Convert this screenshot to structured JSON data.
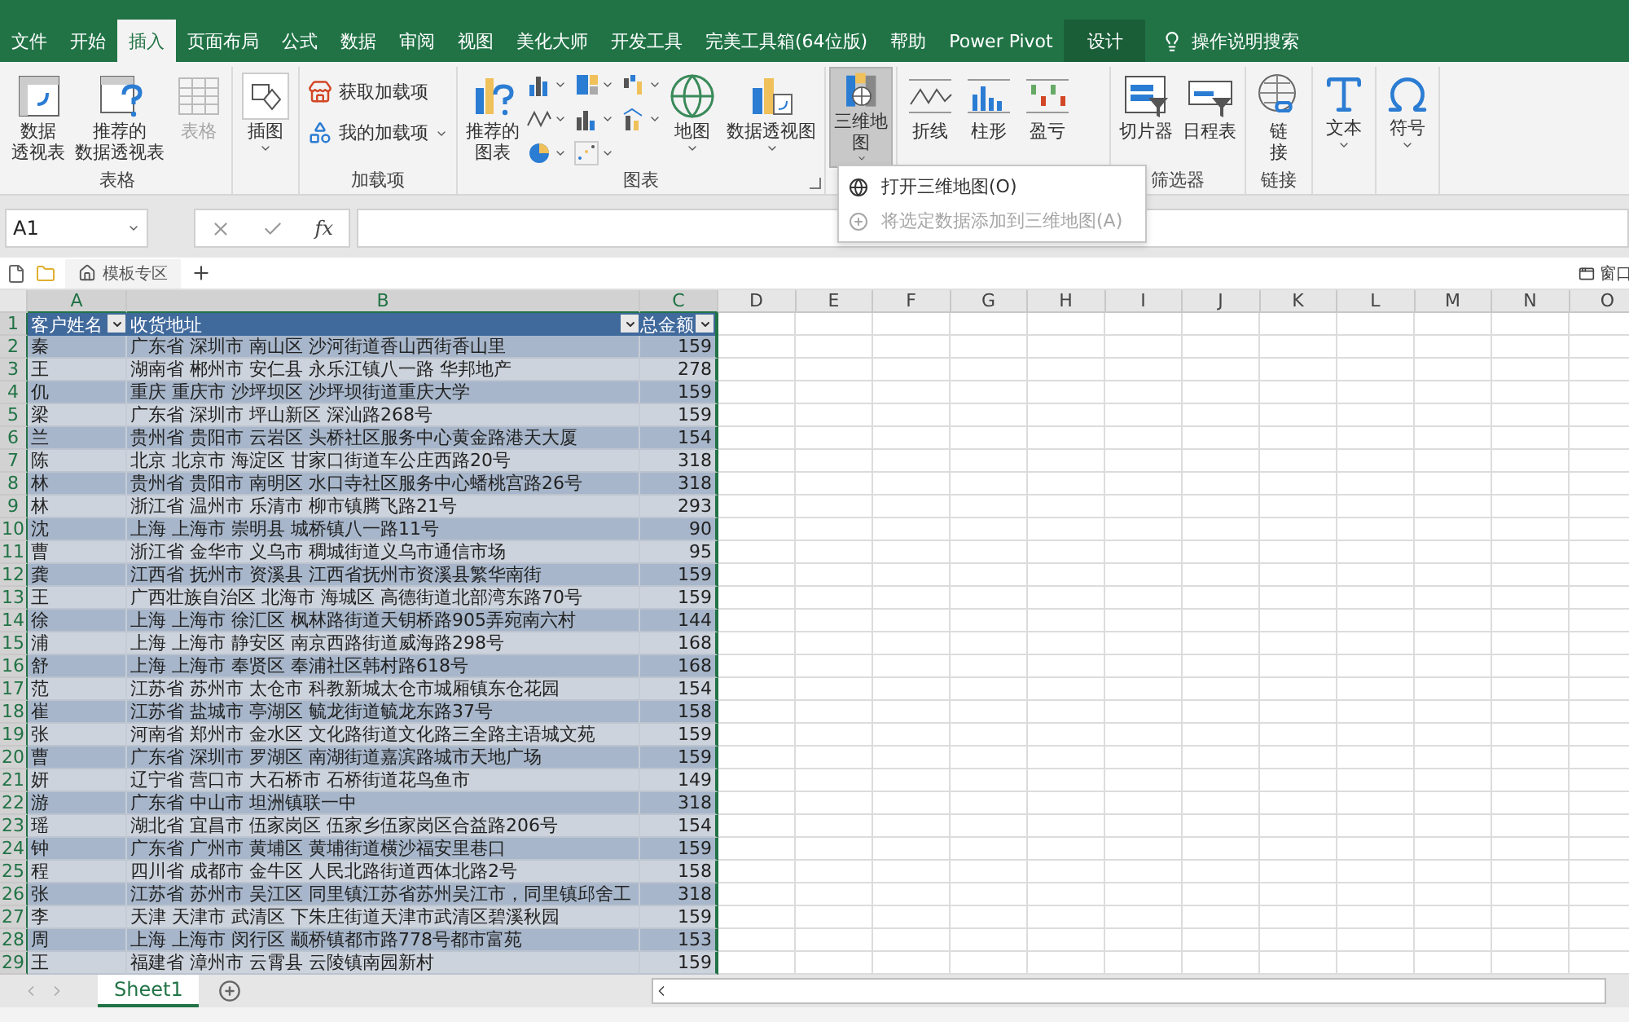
{
  "ribbon_tabs": [
    {
      "label": "文件",
      "selected": false,
      "kind": "normal"
    },
    {
      "label": "开始",
      "selected": false,
      "kind": "normal"
    },
    {
      "label": "插入",
      "selected": true,
      "kind": "normal"
    },
    {
      "label": "页面布局",
      "selected": false,
      "kind": "normal"
    },
    {
      "label": "公式",
      "selected": false,
      "kind": "normal"
    },
    {
      "label": "数据",
      "selected": false,
      "kind": "normal"
    },
    {
      "label": "审阅",
      "selected": false,
      "kind": "normal"
    },
    {
      "label": "视图",
      "selected": false,
      "kind": "normal"
    },
    {
      "label": "美化大师",
      "selected": false,
      "kind": "normal"
    },
    {
      "label": "开发工具",
      "selected": false,
      "kind": "normal"
    },
    {
      "label": "完美工具箱(64位版)",
      "selected": false,
      "kind": "normal"
    },
    {
      "label": "帮助",
      "selected": false,
      "kind": "normal"
    },
    {
      "label": "Power Pivot",
      "selected": false,
      "kind": "normal"
    },
    {
      "label": "设计",
      "selected": false,
      "kind": "contextual"
    }
  ],
  "tell_me": {
    "placeholder": "操作说明搜索"
  },
  "ribbon_groups": [
    {
      "label": "表格",
      "buttons": [
        {
          "kind": "large",
          "label_lines": [
            "数据",
            "透视表"
          ],
          "dropdown": false,
          "disabled": false,
          "pressed": false
        },
        {
          "kind": "large",
          "label_lines": [
            "推荐的",
            "数据透视表"
          ],
          "dropdown": false,
          "disabled": false,
          "pressed": false
        },
        {
          "kind": "large",
          "label_lines": [
            "表格"
          ],
          "dropdown": false,
          "disabled": true,
          "pressed": false
        }
      ]
    },
    {
      "buttons": [
        {
          "kind": "large",
          "label_lines": [
            "插图"
          ],
          "dropdown": true,
          "disabled": false,
          "pressed": false
        }
      ]
    },
    {
      "label": "加载项",
      "buttons": [
        {
          "kind": "small",
          "label_lines": [
            "获取加载项"
          ],
          "dropdown": false,
          "disabled": false,
          "pressed": false
        },
        {
          "kind": "small",
          "label_lines": [
            "我的加载项"
          ],
          "dropdown": true,
          "disabled": false,
          "pressed": false
        }
      ]
    },
    {
      "label": "图表",
      "launcher": true,
      "buttons": [
        {
          "kind": "large",
          "label_lines": [
            "推荐的",
            "图表"
          ],
          "dropdown": false,
          "disabled": false,
          "pressed": false
        },
        {
          "kind": "icon",
          "dropdown": true,
          "disabled": false,
          "pressed": false
        },
        {
          "kind": "icon",
          "dropdown": true,
          "disabled": false,
          "pressed": false
        },
        {
          "kind": "icon",
          "dropdown": true,
          "disabled": false,
          "pressed": false
        },
        {
          "kind": "icon",
          "dropdown": true,
          "disabled": false,
          "pressed": false
        },
        {
          "kind": "icon",
          "dropdown": true,
          "disabled": false,
          "pressed": false
        },
        {
          "kind": "icon",
          "dropdown": true,
          "disabled": false,
          "pressed": false
        },
        {
          "kind": "icon",
          "dropdown": true,
          "disabled": false,
          "pressed": false
        },
        {
          "kind": "icon",
          "dropdown": true,
          "disabled": false,
          "pressed": false
        },
        {
          "kind": "large",
          "label_lines": [
            "地图"
          ],
          "dropdown": true,
          "disabled": false,
          "pressed": false
        },
        {
          "kind": "large",
          "label_lines": [
            "数据透视图"
          ],
          "dropdown": true,
          "disabled": false,
          "pressed": false
        }
      ]
    },
    {
      "buttons": [
        {
          "kind": "large",
          "label_lines": [
            "三维地",
            "图"
          ],
          "dropdown": true,
          "disabled": false,
          "pressed": true
        }
      ]
    },
    {
      "buttons": [
        {
          "kind": "large",
          "label_lines": [
            "折线"
          ],
          "dropdown": false,
          "disabled": false,
          "pressed": false
        },
        {
          "kind": "large",
          "label_lines": [
            "柱形"
          ],
          "dropdown": false,
          "disabled": false,
          "pressed": false
        },
        {
          "kind": "large",
          "label_lines": [
            "盈亏"
          ],
          "dropdown": false,
          "disabled": false,
          "pressed": false
        }
      ]
    },
    {
      "label": "筛选器",
      "buttons": [
        {
          "kind": "large",
          "label_lines": [
            "切片器"
          ],
          "dropdown": false,
          "disabled": false,
          "pressed": false
        },
        {
          "kind": "large",
          "label_lines": [
            "日程表"
          ],
          "dropdown": false,
          "disabled": false,
          "pressed": false
        }
      ]
    },
    {
      "label": "链接",
      "buttons": [
        {
          "kind": "large",
          "label_lines": [
            "链",
            "接"
          ],
          "dropdown": false,
          "disabled": false,
          "pressed": false
        }
      ]
    },
    {
      "buttons": [
        {
          "kind": "large",
          "label_lines": [
            "文本"
          ],
          "dropdown": true,
          "disabled": false,
          "pressed": false
        }
      ]
    },
    {
      "buttons": [
        {
          "kind": "large",
          "label_lines": [
            "符号"
          ],
          "dropdown": true,
          "disabled": false,
          "pressed": false
        }
      ]
    }
  ],
  "dropdown_menu": [
    {
      "label": "打开三维地图(O)",
      "disabled": false
    },
    {
      "label": "将选定数据添加到三维地图(A)",
      "disabled": true
    }
  ],
  "formula_bar": {
    "name_box": "A1",
    "function_button": "fx"
  },
  "doc_tabs": {
    "template_tab": "模板专区",
    "window_button": "窗口"
  },
  "grid": {
    "column_headers": [
      {
        "label": "A",
        "selected": true
      },
      {
        "label": "B",
        "selected": true
      },
      {
        "label": "C",
        "selected": true
      },
      {
        "label": "D",
        "selected": false
      },
      {
        "label": "E",
        "selected": false
      },
      {
        "label": "F",
        "selected": false
      },
      {
        "label": "G",
        "selected": false
      },
      {
        "label": "H",
        "selected": false
      },
      {
        "label": "I",
        "selected": false
      },
      {
        "label": "J",
        "selected": false
      },
      {
        "label": "K",
        "selected": false
      },
      {
        "label": "L",
        "selected": false
      },
      {
        "label": "M",
        "selected": false
      },
      {
        "label": "N",
        "selected": false
      },
      {
        "label": "O",
        "selected": false
      }
    ],
    "row_numbers": [
      "1",
      "2",
      "3",
      "4",
      "5",
      "6",
      "7",
      "8",
      "9",
      "10",
      "11",
      "12",
      "13",
      "14",
      "15",
      "16",
      "17",
      "18",
      "19",
      "20",
      "21",
      "22",
      "23",
      "24",
      "25",
      "26",
      "27",
      "28",
      "29"
    ],
    "table_header": [
      "客户姓名",
      "收货地址",
      "总金额"
    ],
    "table_rows": [
      [
        "秦",
        "广东省 深圳市 南山区 沙河街道香山西街香山里",
        "159"
      ],
      [
        "王",
        "湖南省 郴州市 安仁县 永乐江镇八一路 华邦地产",
        "278"
      ],
      [
        "仉",
        "重庆 重庆市 沙坪坝区 沙坪坝街道重庆大学",
        "159"
      ],
      [
        "梁",
        "广东省 深圳市 坪山新区 深汕路268号",
        "159"
      ],
      [
        "兰",
        "贵州省 贵阳市 云岩区 头桥社区服务中心黄金路港天大厦",
        "154"
      ],
      [
        "陈",
        "北京 北京市 海淀区 甘家口街道车公庄西路20号",
        "318"
      ],
      [
        "林",
        "贵州省 贵阳市 南明区 水口寺社区服务中心蟠桃宫路26号",
        "318"
      ],
      [
        "林",
        "浙江省 温州市 乐清市 柳市镇腾飞路21号",
        "293"
      ],
      [
        "沈",
        "上海 上海市 崇明县 城桥镇八一路11号",
        "90"
      ],
      [
        "曹",
        "浙江省 金华市 义乌市 稠城街道义乌市通信市场",
        "95"
      ],
      [
        "龚",
        "江西省 抚州市 资溪县 江西省抚州市资溪县繁华南街",
        "159"
      ],
      [
        "王",
        "广西壮族自治区 北海市 海城区 高德街道北部湾东路70号",
        "159"
      ],
      [
        "徐",
        "上海 上海市 徐汇区 枫林路街道天钥桥路905弄宛南六村",
        "144"
      ],
      [
        "浦",
        "上海 上海市 静安区 南京西路街道威海路298号",
        "168"
      ],
      [
        "舒",
        "上海 上海市 奉贤区 奉浦社区韩村路618号",
        "168"
      ],
      [
        "范",
        "江苏省 苏州市 太仓市 科教新城太仓市城厢镇东仓花园",
        "154"
      ],
      [
        "崔",
        "江苏省 盐城市 亭湖区 毓龙街道毓龙东路37号",
        "158"
      ],
      [
        "张",
        "河南省 郑州市 金水区 文化路街道文化路三全路主语城文苑",
        "159"
      ],
      [
        "曹",
        "广东省 深圳市 罗湖区 南湖街道嘉滨路城市天地广场",
        "159"
      ],
      [
        "妍",
        "辽宁省 营口市 大石桥市 石桥街道花鸟鱼市",
        "149"
      ],
      [
        "游",
        "广东省 中山市  坦洲镇联一中",
        "318"
      ],
      [
        "瑶",
        "湖北省 宜昌市 伍家岗区 伍家乡伍家岗区合益路206号",
        "154"
      ],
      [
        "钟",
        "广东省 广州市 黄埔区 黄埔街道横沙福安里巷口",
        "159"
      ],
      [
        "程",
        "四川省 成都市 金牛区 人民北路街道西体北路2号",
        "158"
      ],
      [
        "张",
        "江苏省 苏州市 吴江区 同里镇江苏省苏州吴江市，同里镇邱舍工",
        "318"
      ],
      [
        "李",
        "天津 天津市 武清区 下朱庄街道天津市武清区碧溪秋园",
        "159"
      ],
      [
        "周",
        "上海 上海市 闵行区 颛桥镇都市路778号都市富苑",
        "153"
      ],
      [
        "王",
        "福建省 漳州市 云霄县 云陵镇南园新村",
        "159"
      ]
    ]
  },
  "sheet_tabs": [
    {
      "label": "Sheet1",
      "selected": true
    }
  ]
}
